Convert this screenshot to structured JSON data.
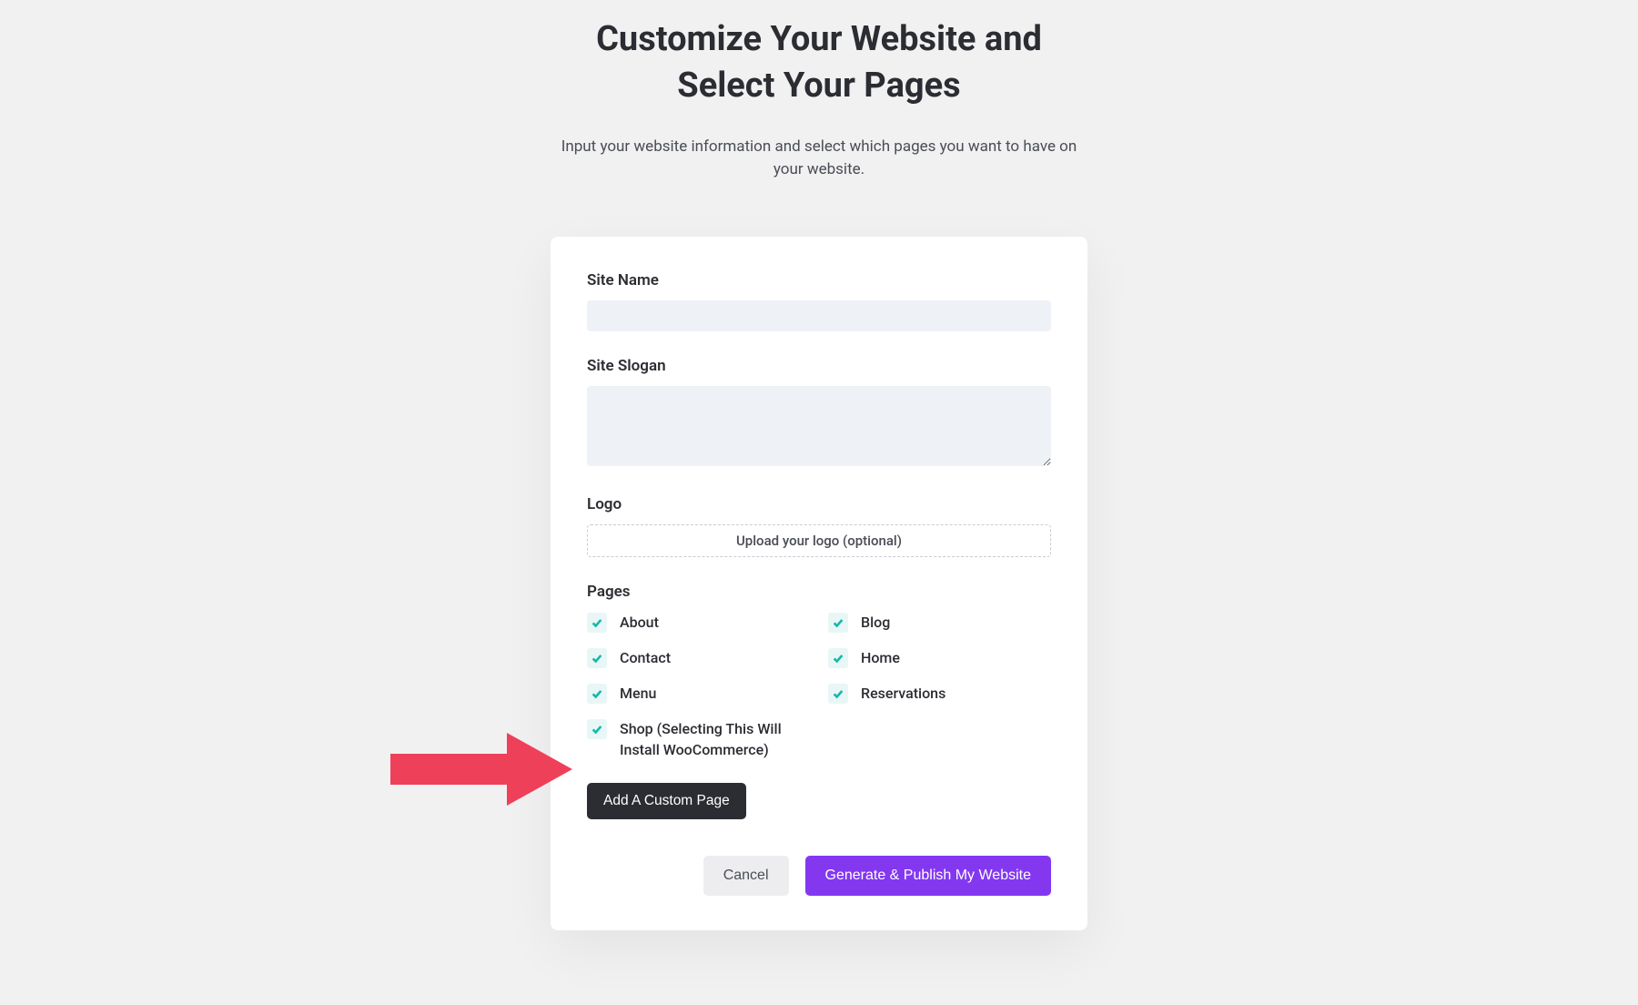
{
  "title_line1": "Customize Your Website and",
  "title_line2": "Select Your Pages",
  "subtitle": "Input your website information and select which pages you want to have on your website.",
  "form": {
    "site_name_label": "Site Name",
    "site_name_value": "",
    "site_slogan_label": "Site Slogan",
    "site_slogan_value": "",
    "logo_label": "Logo",
    "logo_upload_text": "Upload your logo (optional)",
    "pages_label": "Pages",
    "pages": [
      {
        "label": "About",
        "checked": true
      },
      {
        "label": "Blog",
        "checked": true
      },
      {
        "label": "Contact",
        "checked": true
      },
      {
        "label": "Home",
        "checked": true
      },
      {
        "label": "Menu",
        "checked": true
      },
      {
        "label": "Reservations",
        "checked": true
      },
      {
        "label": "Shop (Selecting This Will Install WooCommerce)",
        "checked": true
      }
    ],
    "add_custom_page_label": "Add A Custom Page"
  },
  "buttons": {
    "cancel": "Cancel",
    "generate": "Generate & Publish My Website"
  },
  "annotation": {
    "arrow_color": "#ef4059"
  }
}
